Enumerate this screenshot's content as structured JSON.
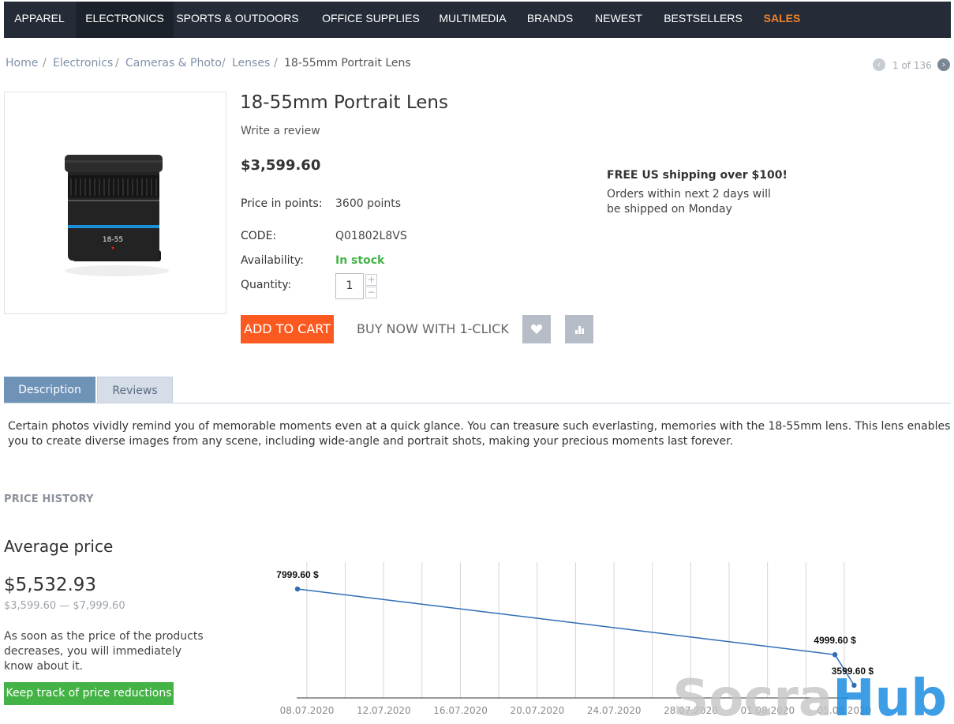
{
  "nav": {
    "items": [
      "APPAREL",
      "ELECTRONICS",
      "SPORTS & OUTDOORS",
      "OFFICE SUPPLIES",
      "MULTIMEDIA",
      "BRANDS",
      "NEWEST",
      "BESTSELLERS",
      "SALES"
    ],
    "active": "ELECTRONICS",
    "highlight": "SALES",
    "highlight_color": "#f0822e"
  },
  "breadcrumb": {
    "items": [
      "Home",
      "Electronics",
      "Cameras & Photo",
      "Lenses",
      "18-55mm Portrait Lens"
    ],
    "separator": "/"
  },
  "pager": {
    "text": "1 of 136",
    "prev_icon": "chevron-left-icon",
    "next_icon": "chevron-right-icon"
  },
  "product": {
    "title": "18-55mm Portrait Lens",
    "review_link": "Write a review",
    "price": "$3,599.60",
    "points_label": "Price in points:",
    "points_value": "3600 points",
    "code_label": "CODE:",
    "code_value": "Q01802L8VS",
    "availability_label": "Availability:",
    "availability_value": "In stock",
    "availability_color": "#44b346",
    "quantity_label": "Quantity:",
    "quantity_value": "1",
    "lens_marking": "18-55",
    "add_to_cart": "ADD TO CART",
    "buy_now": "BUY NOW WITH 1-CLICK",
    "wishlist_icon": "heart-icon",
    "compare_icon": "bar-chart-icon"
  },
  "shipping": {
    "headline": "FREE US shipping over $100!",
    "line1": "Orders within next 2 days will",
    "line2": "be shipped on Monday"
  },
  "tabs": {
    "description": "Description",
    "reviews": "Reviews",
    "active": "Description"
  },
  "description": "Certain photos vividly remind you of memorable moments even at a quick glance. You can treasure such everlasting, memories with the 18-55mm lens. This lens enables you to create diverse images from any scene, including wide-angle and portrait shots, making your precious moments last forever.",
  "price_history": {
    "section_title": "PRICE HISTORY",
    "avg_title": "Average price",
    "avg_value": "$5,532.93",
    "range": "$3,599.60 — $7,999.60",
    "note": "As soon as the price of the products decreases, you will immediately know about it.",
    "button": "Keep track of price reductions"
  },
  "watermark": "SocraHub",
  "chart_data": {
    "type": "line",
    "x_ticks": [
      "08.07.2020",
      "12.07.2020",
      "16.07.2020",
      "20.07.2020",
      "24.07.2020",
      "28.07.2020",
      "01.08.2020",
      "05.08.2020"
    ],
    "points": [
      {
        "x": "08.07.2020",
        "y": 7999.6,
        "label": "7999.60 $"
      },
      {
        "x": "05.08.2020",
        "y": 4999.6,
        "label": "4999.60 $"
      },
      {
        "x": "06.08.2020",
        "y": 3599.6,
        "label": "3599.60 $"
      }
    ],
    "grid": true,
    "line_color": "#2f6db5"
  }
}
